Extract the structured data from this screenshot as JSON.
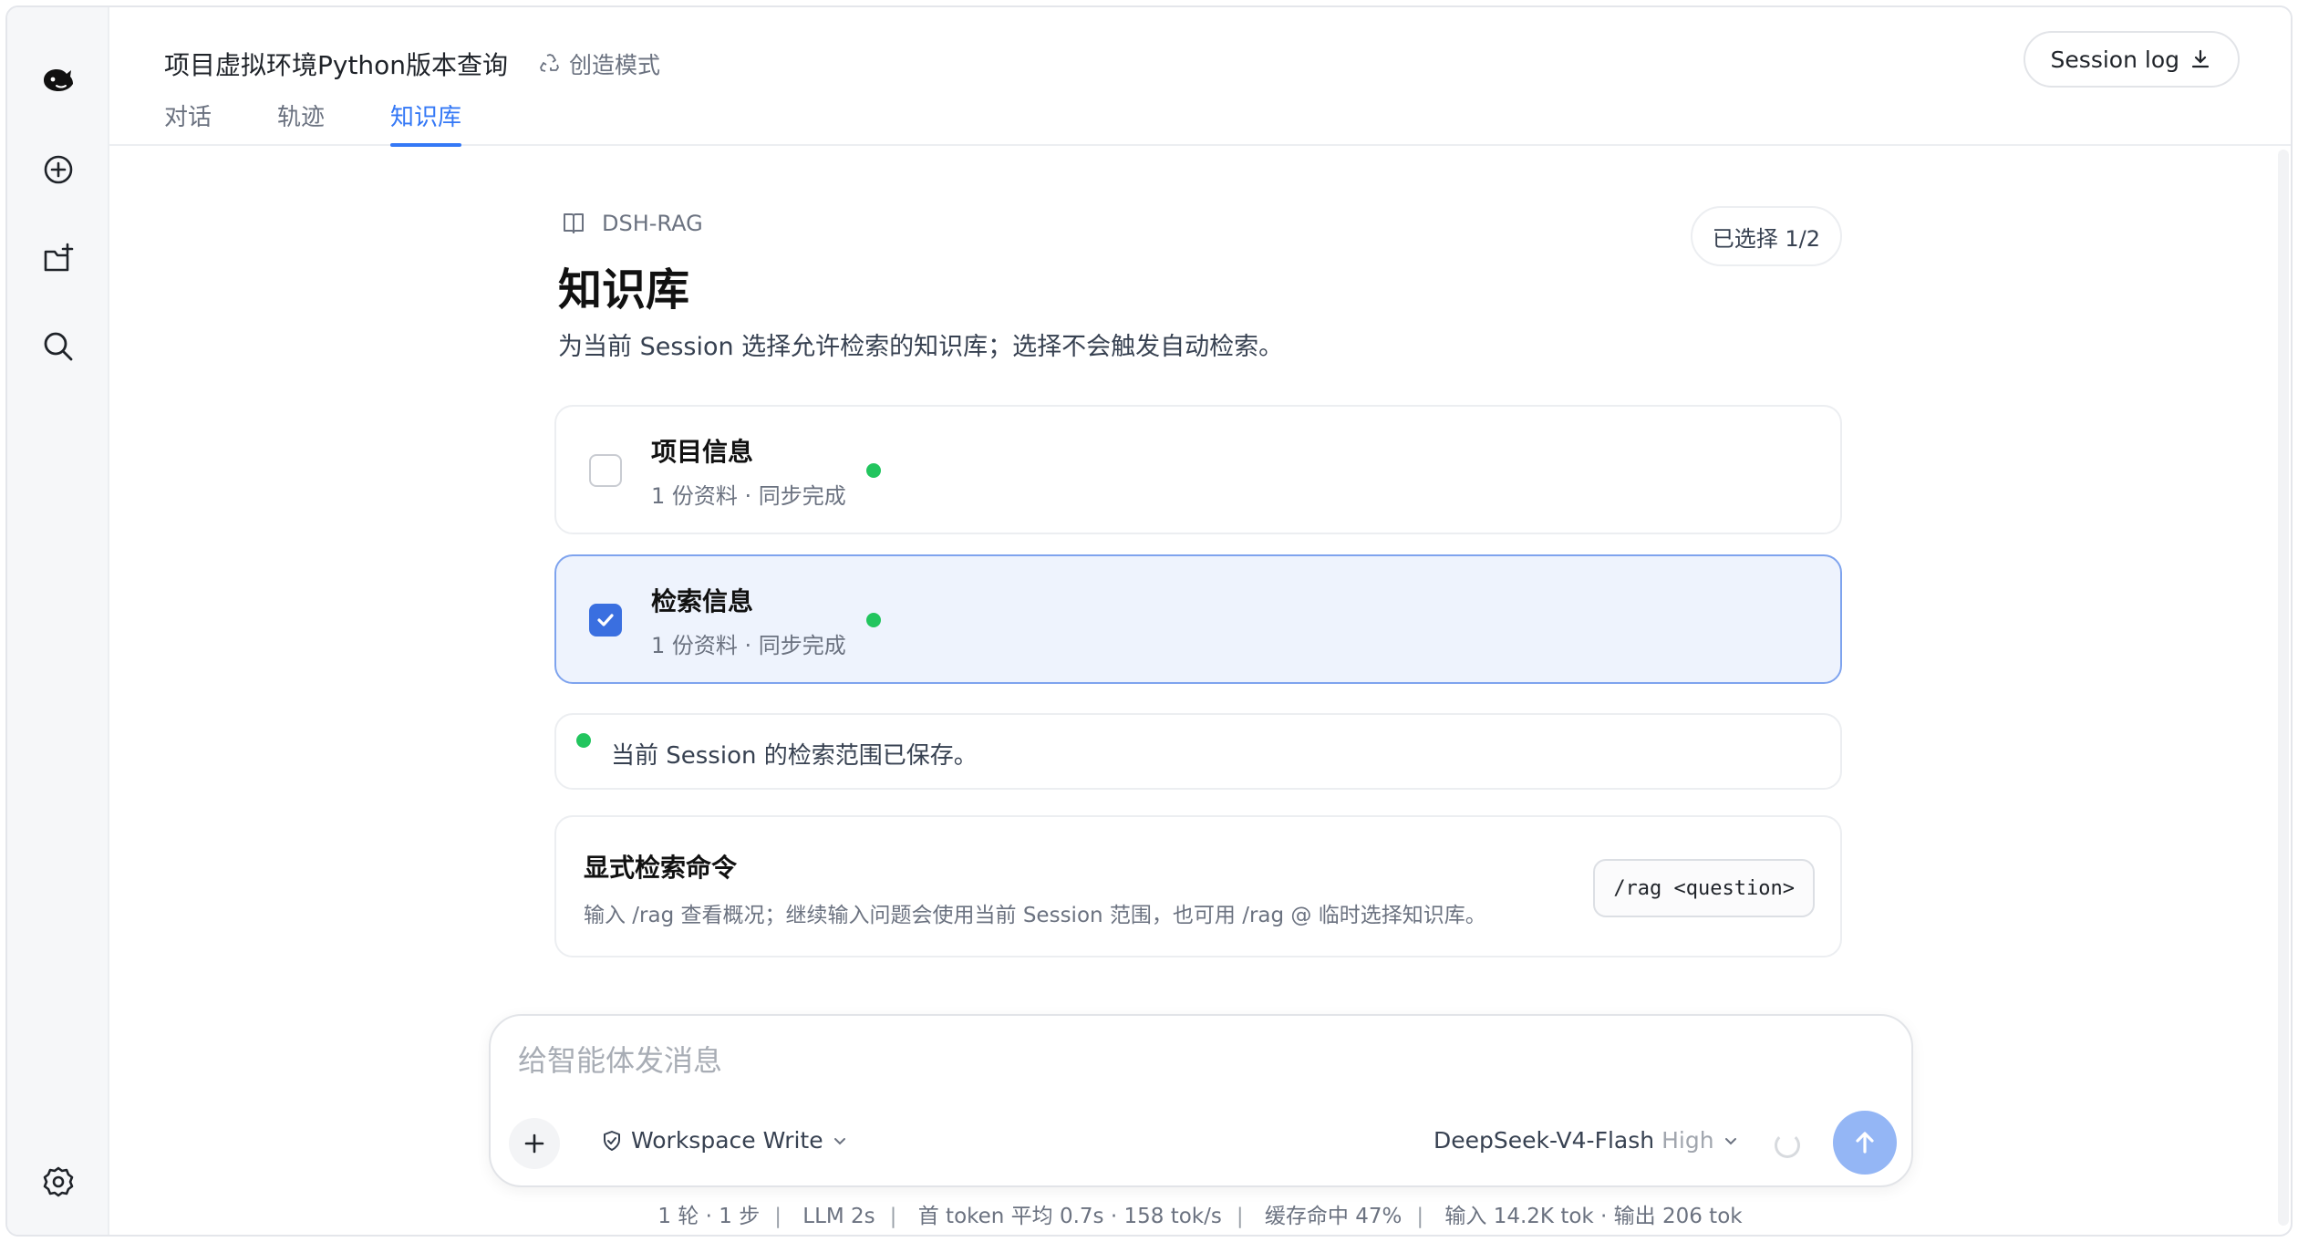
{
  "header": {
    "title": "项目虚拟环境Python版本查询",
    "mode_label": "创造模式",
    "session_log_label": "Session log",
    "tabs": [
      {
        "label": "对话"
      },
      {
        "label": "轨迹"
      },
      {
        "label": "知识库"
      }
    ],
    "active_tab": "知识库"
  },
  "knowledge": {
    "breadcrumb": "DSH-RAG",
    "title": "知识库",
    "selected_badge": "已选择 1/2",
    "description": "为当前 Session 选择允许检索的知识库；选择不会触发自动检索。",
    "items": [
      {
        "name": "项目信息",
        "meta": "1 份资料 · 同步完成",
        "checked": false,
        "status_color": "#22c55e"
      },
      {
        "name": "检索信息",
        "meta": "1 份资料 · 同步完成",
        "checked": true,
        "status_color": "#22c55e"
      }
    ],
    "notice": "当前 Session 的检索范围已保存。",
    "command": {
      "title": "显式检索命令",
      "description": "输入 /rag 查看概况；继续输入问题会使用当前 Session 范围，也可用 /rag @ 临时选择知识库。",
      "code": "/rag <question>"
    }
  },
  "composer": {
    "placeholder": "给智能体发消息",
    "value": "",
    "permission": "Workspace Write",
    "model": "DeepSeek-V4-Flash",
    "effort": "High"
  },
  "stats": {
    "turns": "1 轮 · 1 步",
    "llm": "LLM 2s",
    "first_token": "首 token 平均 0.7s · 158 tok/s",
    "cache": "缓存命中 47%",
    "io": "输入 14.2K tok · 输出 206 tok"
  },
  "colors": {
    "accent": "#3478f6",
    "checkbox": "#3a6fe0",
    "status_green": "#22c55e",
    "send_button": "#94b6f5"
  },
  "icons": {
    "logo": "whale-logo-icon",
    "new_chat": "plus-circle-icon",
    "new_folder": "folder-plus-icon",
    "search": "search-icon",
    "settings": "gear-icon"
  }
}
